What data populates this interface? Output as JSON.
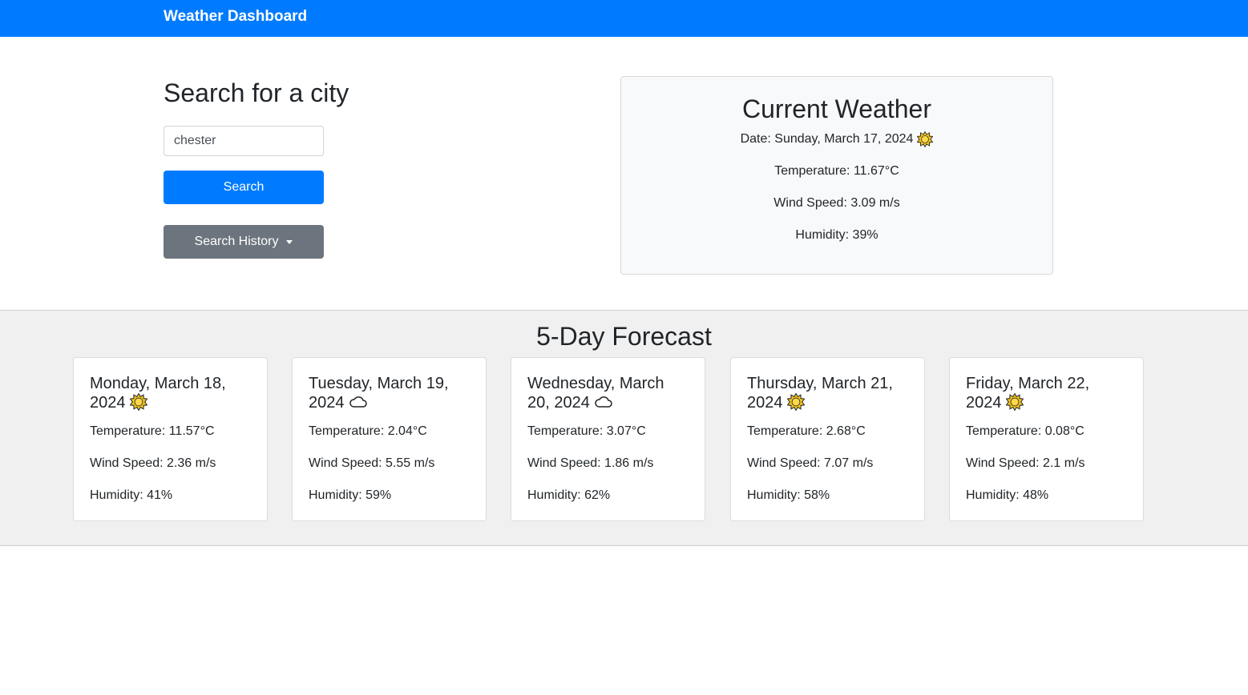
{
  "navbar": {
    "brand": "Weather Dashboard"
  },
  "search": {
    "title": "Search for a city",
    "input_value": "chester",
    "search_label": "Search",
    "history_label": "Search History"
  },
  "current": {
    "title": "Current Weather",
    "date": "Date: Sunday, March 17, 2024",
    "icon": "sun-icon",
    "temperature": "Temperature: 11.67°C",
    "wind": "Wind Speed: 3.09 m/s",
    "humidity": "Humidity: 39%"
  },
  "forecast": {
    "title": "5-Day Forecast",
    "days": [
      {
        "date_line1": "Monday, March 18,",
        "date_line2": "2024",
        "icon": "sun-icon",
        "temperature": "Temperature: 11.57°C",
        "wind": "Wind Speed: 2.36 m/s",
        "humidity": "Humidity: 41%"
      },
      {
        "date_line1": "Tuesday, March 19,",
        "date_line2": "2024",
        "icon": "cloud-icon",
        "temperature": "Temperature: 2.04°C",
        "wind": "Wind Speed: 5.55 m/s",
        "humidity": "Humidity: 59%"
      },
      {
        "date_line1": "Wednesday, March",
        "date_line2": "20, 2024",
        "icon": "cloud-icon",
        "temperature": "Temperature: 3.07°C",
        "wind": "Wind Speed: 1.86 m/s",
        "humidity": "Humidity: 62%"
      },
      {
        "date_line1": "Thursday, March 21,",
        "date_line2": "2024",
        "icon": "sun-icon",
        "temperature": "Temperature: 2.68°C",
        "wind": "Wind Speed: 7.07 m/s",
        "humidity": "Humidity: 58%"
      },
      {
        "date_line1": "Friday, March 22,",
        "date_line2": "2024",
        "icon": "sun-icon",
        "temperature": "Temperature: 0.08°C",
        "wind": "Wind Speed: 2.1 m/s",
        "humidity": "Humidity: 48%"
      }
    ]
  },
  "colors": {
    "primary": "#007bff",
    "secondary": "#6c757d",
    "sun": "#f5c518"
  }
}
